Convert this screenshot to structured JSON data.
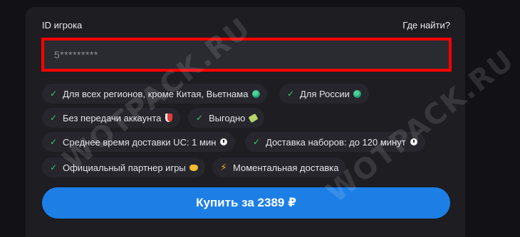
{
  "form": {
    "player_id_label": "ID игрока",
    "help_link": "Где найти?",
    "player_id_value": "5*********"
  },
  "features": [
    {
      "text": "Для всех регионов, кроме Китая, Вьетнама",
      "icon": "check-icon",
      "emoji": "globe-icon"
    },
    {
      "text": "Для России",
      "icon": "check-icon",
      "emoji": "globe-icon"
    },
    {
      "text": "Без передачи аккаунта",
      "icon": "check-icon",
      "emoji": "shield-icon"
    },
    {
      "text": "Выгодно",
      "icon": "check-icon",
      "emoji": "money-icon"
    },
    {
      "text": "Среднее время доставки UC: 1 мин",
      "icon": "check-icon",
      "emoji": "clock-icon"
    },
    {
      "text": "Доставка наборов: до 120 минут",
      "icon": "check-icon",
      "emoji": "clock-icon"
    },
    {
      "text": "Официальный партнер игры",
      "icon": "check-icon",
      "emoji": "handshake-icon"
    },
    {
      "text": "Моментальная доставка",
      "icon": "lightning-icon",
      "emoji": ""
    }
  ],
  "buy_button": "Купить за 2389 ₽",
  "watermark": "WOTPACK.RU",
  "colors": {
    "accent": "#1d7fe6",
    "check": "#35c977",
    "highlight_border": "#ff0000",
    "card_bg": "#1d1d22"
  }
}
